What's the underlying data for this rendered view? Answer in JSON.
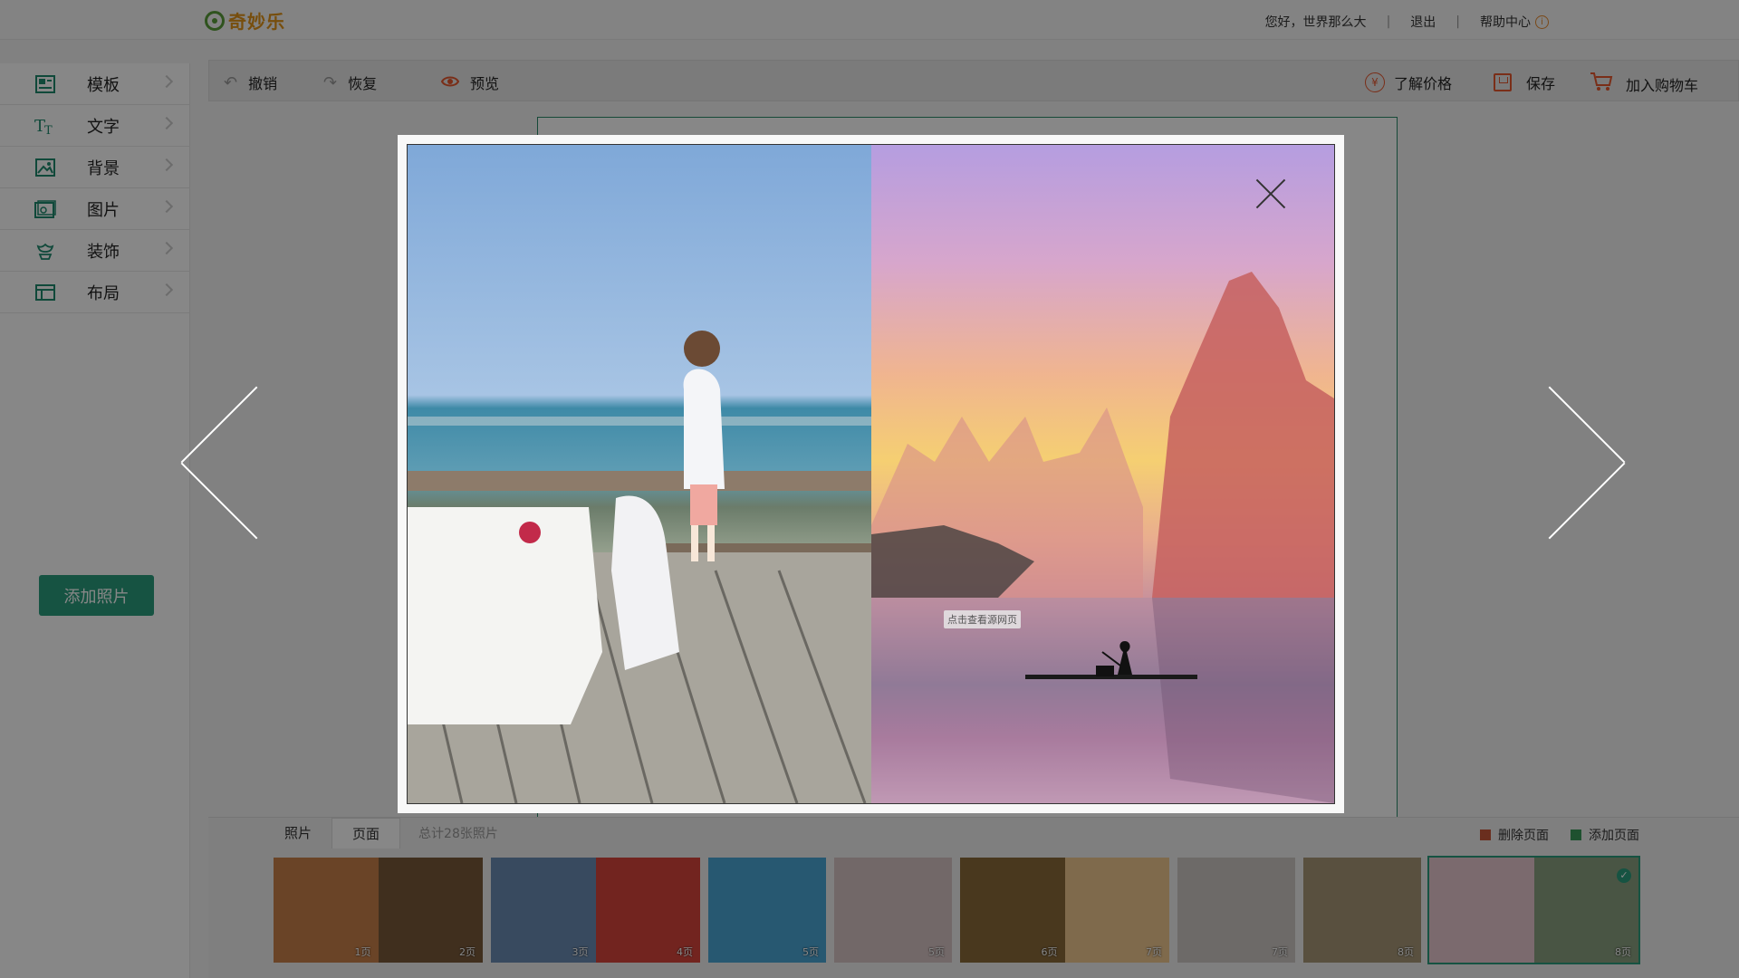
{
  "header": {
    "logo_text": "奇妙乐",
    "greeting": "您好，世界那么大",
    "logout": "退出",
    "sep": "|",
    "help": "帮助中心",
    "help_icon": "i"
  },
  "sidebar": {
    "items": [
      {
        "label": "模板",
        "icon": "template-icon"
      },
      {
        "label": "文字",
        "icon": "text-icon"
      },
      {
        "label": "背景",
        "icon": "background-icon"
      },
      {
        "label": "图片",
        "icon": "image-icon"
      },
      {
        "label": "装饰",
        "icon": "decoration-icon"
      },
      {
        "label": "布局",
        "icon": "layout-icon"
      }
    ],
    "add_photo": "添加照片"
  },
  "toolbar": {
    "undo": "撤销",
    "redo": "恢复",
    "preview": "预览",
    "price": "了解价格",
    "price_icon_glyph": "¥",
    "save": "保存",
    "cart": "加入购物车"
  },
  "bottom": {
    "tab_photos": "照片",
    "tab_pages": "页面",
    "count": "总计28张照片",
    "delete_page": "删除页面",
    "add_page": "添加页面",
    "pages": [
      {
        "labels": [
          "1页",
          "2页"
        ],
        "colors": [
          "#c9814a",
          "#7a5a3a"
        ],
        "selected": false
      },
      {
        "labels": [
          "3页",
          "4页"
        ],
        "colors": [
          "#6a8cb3",
          "#d8453c"
        ],
        "selected": false
      },
      {
        "labels": [
          "5页"
        ],
        "colors": [
          "#4aa6d6"
        ],
        "selected": false
      },
      {
        "labels": [
          "5页"
        ],
        "colors": [
          "#d8c4c4"
        ],
        "selected": false
      },
      {
        "labels": [
          "6页",
          "7页"
        ],
        "colors": [
          "#8a6a3a",
          "#f0c890"
        ],
        "selected": false
      },
      {
        "labels": [
          "7页"
        ],
        "colors": [
          "#cfc9c4"
        ],
        "selected": false
      },
      {
        "labels": [
          "8页"
        ],
        "colors": [
          "#a89878"
        ],
        "selected": false
      },
      {
        "labels": [
          "",
          "8页"
        ],
        "colors": [
          "#e8c8d0",
          "#8aa080"
        ],
        "selected": true
      }
    ]
  },
  "modal": {
    "view_source": "点击查看源网页",
    "left_photo": "child-on-deck-photo",
    "right_photo": "river-mountains-photo"
  }
}
